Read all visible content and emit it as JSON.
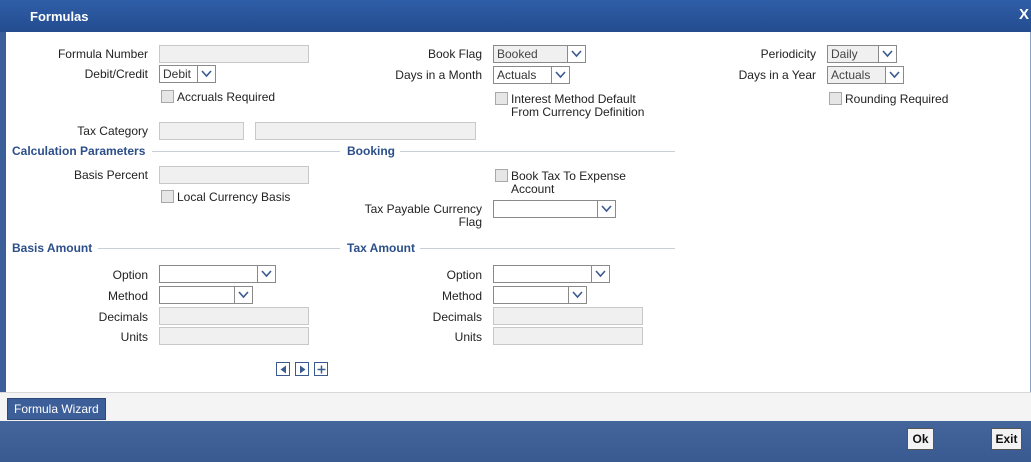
{
  "window": {
    "title": "Formulas",
    "close": "X"
  },
  "form": {
    "formula_number_label": "Formula Number",
    "formula_number_value": "",
    "debit_credit_label": "Debit/Credit",
    "debit_credit_value": "Debit",
    "accruals_required_label": "Accruals Required",
    "book_flag_label": "Book Flag",
    "book_flag_value": "Booked",
    "days_in_month_label": "Days in a Month",
    "days_in_month_value": "Actuals",
    "interest_method_label_line1": "Interest Method Default",
    "interest_method_label_line2": "From Currency Definition",
    "periodicity_label": "Periodicity",
    "periodicity_value": "Daily",
    "days_in_year_label": "Days in a Year",
    "days_in_year_value": "Actuals",
    "rounding_required_label": "Rounding Required",
    "tax_category_label": "Tax Category",
    "tax_category_value": "",
    "tax_category_desc": ""
  },
  "calculation": {
    "header": "Calculation Parameters",
    "basis_percent_label": "Basis Percent",
    "basis_percent_value": "",
    "local_currency_basis_label": "Local Currency Basis"
  },
  "booking": {
    "header": "Booking",
    "book_tax_label_line1": "Book Tax To Expense",
    "book_tax_label_line2": "Account",
    "tax_payable_label_line1": "Tax Payable Currency",
    "tax_payable_label_line2": "Flag",
    "tax_payable_value": ""
  },
  "basis_amount": {
    "header": "Basis Amount",
    "option_label": "Option",
    "option_value": "",
    "method_label": "Method",
    "method_value": "",
    "decimals_label": "Decimals",
    "decimals_value": "",
    "units_label": "Units",
    "units_value": ""
  },
  "tax_amount": {
    "header": "Tax Amount",
    "option_label": "Option",
    "option_value": "",
    "method_label": "Method",
    "method_value": "",
    "decimals_label": "Decimals",
    "decimals_value": "",
    "units_label": "Units",
    "units_value": ""
  },
  "footer": {
    "wizard_label": "Formula Wizard",
    "ok_label": "Ok",
    "exit_label": "Exit"
  },
  "colors": {
    "title_bar": "#2f5ea8",
    "section_header": "#2c4f8a",
    "footer": "#3f6097"
  }
}
